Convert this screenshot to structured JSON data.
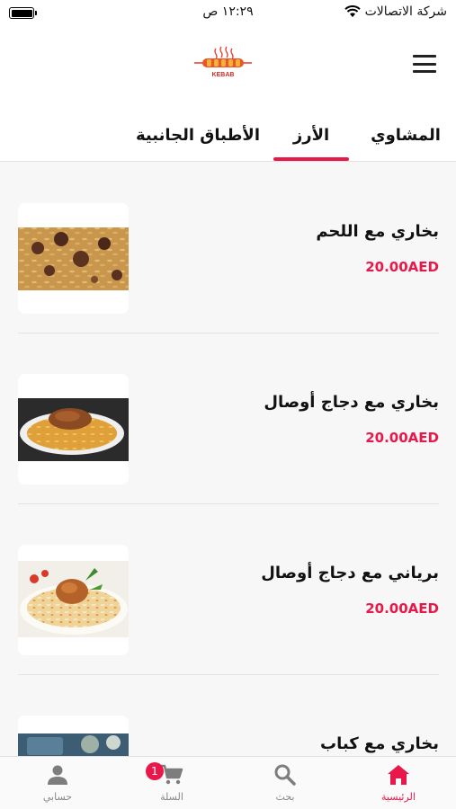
{
  "status_bar": {
    "carrier": "شركة الاتصالات",
    "time": "١٢:٢٩ ص"
  },
  "header": {
    "logo_text": "KEBAB",
    "menu_icon": "hamburger-menu-icon"
  },
  "tabs": [
    {
      "label": "المشاوي",
      "active": false
    },
    {
      "label": "الأرز",
      "active": true
    },
    {
      "label": "الأطباق الجانبية",
      "active": false
    }
  ],
  "items": [
    {
      "name": "بخاري مع اللحم",
      "price": "20.00AED"
    },
    {
      "name": "بخاري مع دجاج أوصال",
      "price": "20.00AED"
    },
    {
      "name": "برياني مع دجاج أوصال",
      "price": "20.00AED"
    },
    {
      "name": "بخاري مع كباب",
      "price": ""
    }
  ],
  "bottom_nav": {
    "home": "الرئيسية",
    "search": "بحث",
    "cart": "السلة",
    "cart_badge": "1",
    "account": "حسابي"
  },
  "colors": {
    "accent": "#e8194a"
  }
}
